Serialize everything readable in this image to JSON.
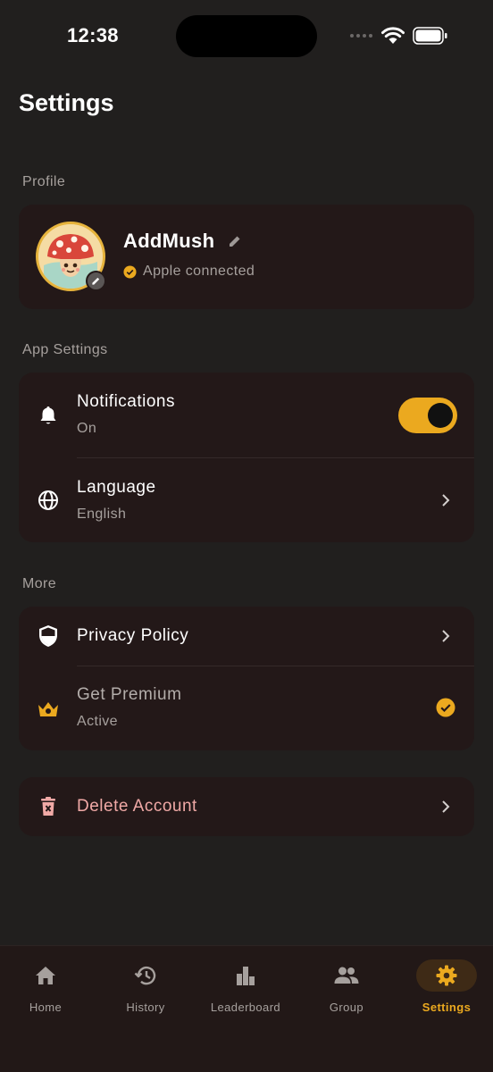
{
  "status_bar": {
    "time": "12:38"
  },
  "page_title": "Settings",
  "sections": {
    "profile": "Profile",
    "app_settings": "App Settings",
    "more": "More"
  },
  "profile": {
    "name": "AddMush",
    "connection": "Apple connected"
  },
  "app_settings": {
    "notifications": {
      "title": "Notifications",
      "value": "On",
      "enabled": true
    },
    "language": {
      "title": "Language",
      "value": "English"
    }
  },
  "more": {
    "privacy": {
      "title": "Privacy Policy"
    },
    "premium": {
      "title": "Get Premium",
      "status": "Active"
    }
  },
  "danger": {
    "delete": "Delete Account"
  },
  "tabs": [
    {
      "label": "Home",
      "icon": "home-icon",
      "active": false
    },
    {
      "label": "History",
      "icon": "history-icon",
      "active": false
    },
    {
      "label": "Leaderboard",
      "icon": "leaderboard-icon",
      "active": false
    },
    {
      "label": "Group",
      "icon": "group-icon",
      "active": false
    },
    {
      "label": "Settings",
      "icon": "gear-icon",
      "active": true
    }
  ],
  "colors": {
    "background": "#211f1e",
    "card": "#231818",
    "accent": "#eba91f",
    "danger_text": "#f0a9a6",
    "muted_text": "#a6a09d"
  }
}
